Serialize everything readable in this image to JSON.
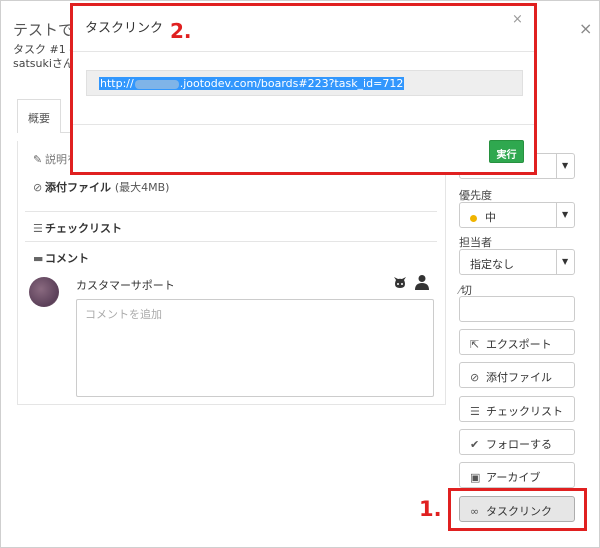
{
  "background": {
    "task_title": "テストで",
    "task_sub": "タスク #1 -",
    "task_by": "satsukiさん",
    "close": "×",
    "tab_overview": "概要",
    "description": "説明を",
    "attachments": "添付ファイル",
    "attachments_limit": "(最大4MB)",
    "checklist": "チェックリスト",
    "comments": "コメント",
    "comment_user": "カスタマーサポート",
    "comment_placeholder": "コメントを追加"
  },
  "sidebar": {
    "priority_label": "優先度",
    "priority_value": "中",
    "assignee_label": "担当者",
    "assignee_value": "指定なし",
    "deadline_label": "期限",
    "deadline_label_shown": "切",
    "buttons": [
      {
        "label": "エクスポート",
        "icon": "export-icon"
      },
      {
        "label": "添付ファイル",
        "icon": "paperclip-icon"
      },
      {
        "label": "チェックリスト",
        "icon": "list-icon"
      },
      {
        "label": "フォローする",
        "icon": "follow-icon"
      },
      {
        "label": "アーカイブ",
        "icon": "archive-icon"
      },
      {
        "label": "タスクリンク",
        "icon": "link-icon"
      }
    ]
  },
  "modal": {
    "title": "タスクリンク",
    "close": "×",
    "url_prefix": "http://",
    "url_suffix": ".jootodev.com/boards#223?task_id=712",
    "run_label": "実行"
  },
  "annotations": {
    "step1": "1.",
    "step2": "2.",
    "highlight_color": "#e02020"
  },
  "colors": {
    "run_button": "#2fa84f",
    "selection": "#3297fd",
    "priority_dot": "#f0b400"
  }
}
